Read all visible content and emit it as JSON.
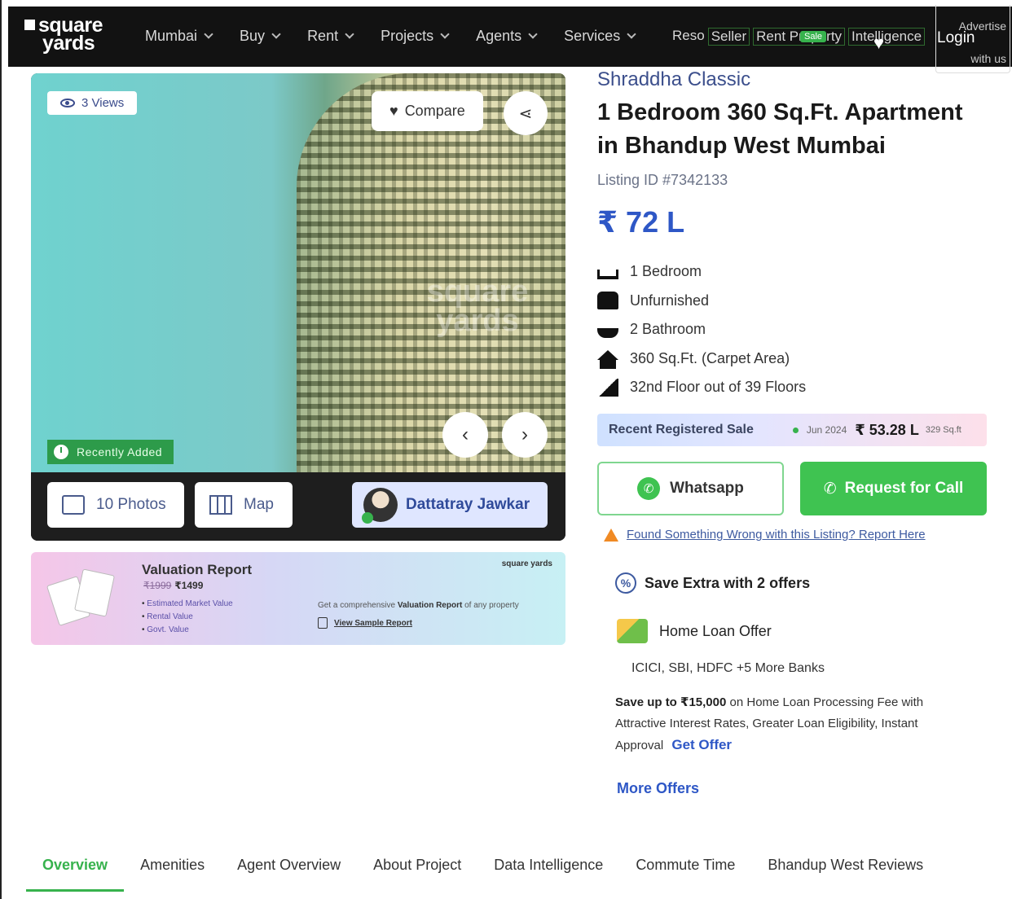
{
  "header": {
    "logo_line1": "square",
    "logo_line2": "yards",
    "nav": [
      {
        "label": "Mumbai"
      },
      {
        "label": "Buy"
      },
      {
        "label": "Rent"
      },
      {
        "label": "Projects"
      },
      {
        "label": "Agents"
      },
      {
        "label": "Services"
      }
    ],
    "extra_links": [
      "Reso",
      "Seller",
      "Rent Property",
      "Intelligence"
    ],
    "sale_badge": "Sale",
    "login": "Login",
    "advertise": "Advertise with us"
  },
  "gallery": {
    "views": "3 Views",
    "compare": "Compare",
    "recently_added": "Recently Added",
    "photos": "10 Photos",
    "map": "Map",
    "agent_name": "Dattatray Jawkar",
    "watermark": "square yards"
  },
  "valuation": {
    "title": "Valuation Report",
    "old_price": "₹1999",
    "price": "₹1499",
    "items": [
      "Estimated Market Value",
      "Rental Value",
      "Govt. Value"
    ],
    "brand": "square yards",
    "desc_prefix": "Get a comprehensive",
    "desc_bold": "Valuation Report",
    "desc_suffix": "of any property",
    "sample_link": "View Sample Report"
  },
  "listing": {
    "project": "Shraddha Classic",
    "title": "1 Bedroom 360 Sq.Ft. Apartment in Bhandup West Mumbai",
    "listing_id": "Listing ID #7342133",
    "price": "₹ 72 L",
    "features": [
      {
        "icon": "bed-icon",
        "text": "1 Bedroom"
      },
      {
        "icon": "sofa-icon",
        "text": "Unfurnished"
      },
      {
        "icon": "bathtub-icon",
        "text": "2 Bathroom"
      },
      {
        "icon": "home-icon",
        "text": "360 Sq.Ft. (Carpet Area)"
      },
      {
        "icon": "stairs-icon",
        "text": "32nd Floor out of 39 Floors"
      }
    ]
  },
  "recent_sale": {
    "label": "Recent Registered Sale",
    "date": "Jun 2024",
    "price": "₹ 53.28 L",
    "area": "329 Sq.ft"
  },
  "actions": {
    "whatsapp": "Whatsapp",
    "call": "Request for Call",
    "report": "Found Something Wrong with this Listing? Report Here"
  },
  "offers": {
    "heading": "Save Extra with 2 offers",
    "loan_title": "Home Loan Offer",
    "banks": "ICICI, SBI, HDFC +5 More Banks",
    "desc_bold": "Save up to ₹15,000",
    "desc": "on Home Loan Processing Fee with Attractive Interest Rates, Greater Loan Eligibility, Instant Approval",
    "get_offer": "Get Offer",
    "more": "More Offers"
  },
  "tabs": [
    {
      "label": "Overview"
    },
    {
      "label": "Amenities"
    },
    {
      "label": "Agent Overview"
    },
    {
      "label": "About Project"
    },
    {
      "label": "Data Intelligence"
    },
    {
      "label": "Commute Time"
    },
    {
      "label": "Bhandup West Reviews"
    }
  ],
  "colors": {
    "accent_green": "#37b24d",
    "price_blue": "#2e57c6",
    "nav_bg": "#121212"
  }
}
